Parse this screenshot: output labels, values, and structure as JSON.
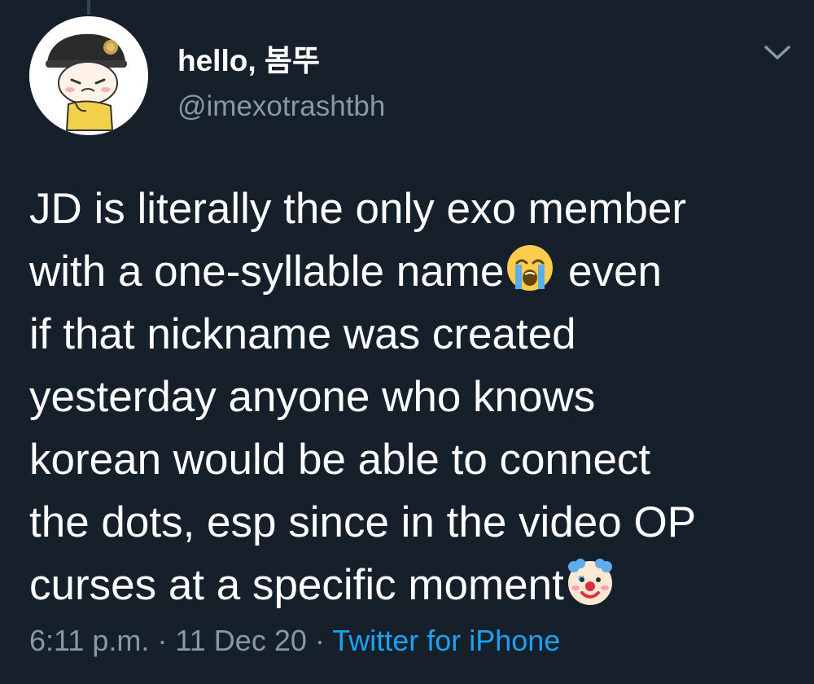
{
  "author": {
    "display_name": "hello, 봄뚜",
    "handle": "@imexotrashtbh",
    "avatar_icon": "cartoon-boy-with-military-cap"
  },
  "menu": {
    "icon": "chevron-down-icon"
  },
  "tweet": {
    "lines": [
      "JD is literally the only exo member",
      "with a one-syllable name",
      " even",
      "if that nickname was created",
      "yesterday anyone who knows",
      "korean would be able to connect",
      "the dots, esp since in the video OP",
      "curses at a specific moment"
    ],
    "emojis": [
      "loudly-crying-face",
      "clown-face"
    ]
  },
  "meta": {
    "time": "6:11 p.m.",
    "sep1": " · ",
    "date": "11 Dec 20",
    "sep2": " · ",
    "source": "Twitter for iPhone"
  },
  "colors": {
    "background": "#15202b",
    "text": "#ffffff",
    "secondary_text": "#8899a6",
    "link": "#1da1f2"
  }
}
